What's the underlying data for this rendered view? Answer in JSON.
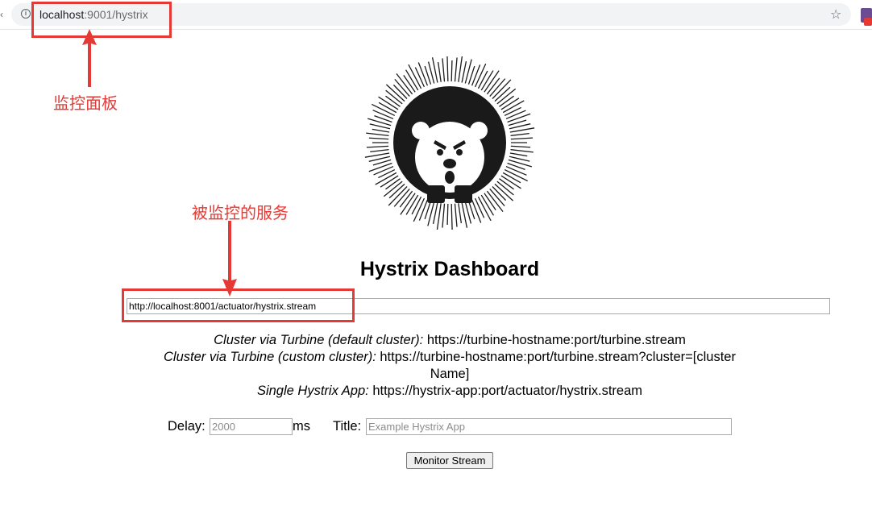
{
  "browser": {
    "url_host": "localhost",
    "url_rest": ":9001/hystrix",
    "icons": [
      "info-icon",
      "star-icon",
      "extension-icon"
    ]
  },
  "annotations": {
    "monitor_panel_label": "监控面板",
    "monitored_service_label": "被监控的服务",
    "color": "#e53935"
  },
  "dashboard": {
    "title": "Hystrix Dashboard",
    "stream_url_value": "http://localhost:8001/actuator/hystrix.stream",
    "examples": [
      {
        "label": "Cluster via Turbine (default cluster):",
        "value": " https://turbine-hostname:port/turbine.stream"
      },
      {
        "label": "Cluster via Turbine (custom cluster):",
        "value": " https://turbine-hostname:port/turbine.stream?cluster=[clusterName]"
      },
      {
        "label": "Single Hystrix App:",
        "value": " https://hystrix-app:port/actuator/hystrix.stream"
      }
    ],
    "delay_label": "Delay:",
    "delay_placeholder": "2000",
    "delay_unit": "ms",
    "title_label": "Title:",
    "title_placeholder": "Example Hystrix App",
    "monitor_button": "Monitor Stream"
  }
}
